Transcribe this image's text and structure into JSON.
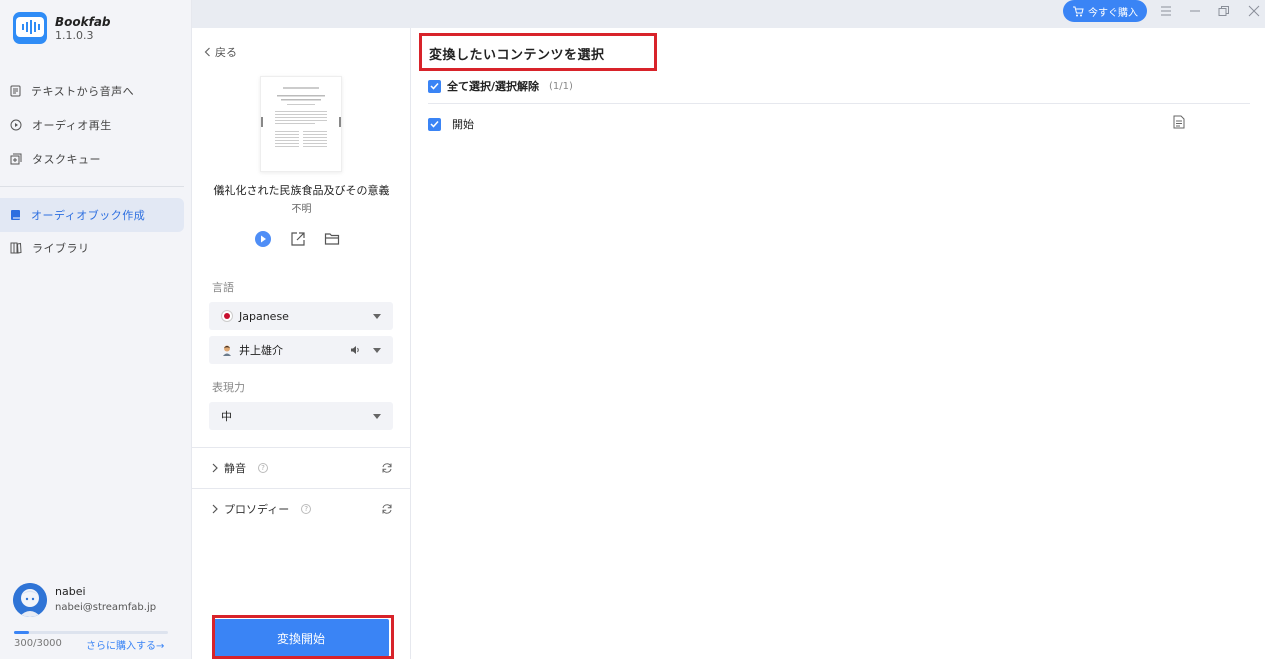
{
  "app": {
    "name": "Bookfab",
    "version": "1.1.0.3",
    "buy_now_label": "今すぐ購入"
  },
  "sidebar": {
    "items": [
      {
        "label": "テキストから音声へ",
        "icon": "document-icon"
      },
      {
        "label": "オーディオ再生",
        "icon": "play-circle-icon"
      },
      {
        "label": "タスクキュー",
        "icon": "queue-icon"
      },
      {
        "label": "オーディオブック作成",
        "icon": "book-icon",
        "active": true
      },
      {
        "label": "ライブラリ",
        "icon": "library-icon"
      }
    ],
    "user": {
      "name": "nabei",
      "email": "nabei@streamfab.jp"
    },
    "quota": {
      "text": "300/3000",
      "used": 300,
      "total": 3000,
      "buy_more_label": "さらに購入する→"
    }
  },
  "middle": {
    "back_label": "戻る",
    "book_title": "儀礼化された民族食品及びその意義",
    "book_author": "不明",
    "language_label": "言語",
    "language_value": "Japanese",
    "voice_value": "井上雄介",
    "expression_label": "表現力",
    "expression_value": "中",
    "silence_label": "静音",
    "prosody_label": "プロソディー",
    "convert_label": "変換開始"
  },
  "content": {
    "title": "変換したいコンテンツを選択",
    "select_all_label": "全て選択/選択解除",
    "select_all_count": "(1/1)",
    "chapters": [
      {
        "label": "開始",
        "checked": true
      }
    ]
  },
  "colors": {
    "accent": "#3a84f5",
    "highlight_box": "#d8232a",
    "sidebar_bg": "#f3f4f8",
    "active_nav_bg": "#e2e8f4"
  }
}
